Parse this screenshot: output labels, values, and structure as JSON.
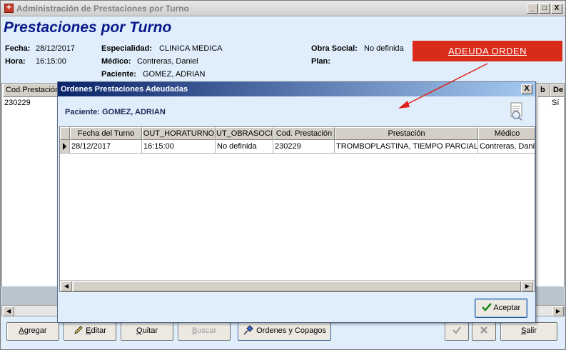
{
  "window": {
    "title": "Administración de Prestaciones por Turno",
    "minimize": "_",
    "maximize": "□",
    "close": "X"
  },
  "heading": "Prestaciones por Turno",
  "info": {
    "fecha_label": "Fecha:",
    "fecha": "28/12/2017",
    "hora_label": "Hora:",
    "hora": "16:15:00",
    "especialidad_label": "Especialidad:",
    "especialidad": "CLINICA MEDICA",
    "medico_label": "Médico:",
    "medico": "Contreras, Daniel",
    "paciente_label": "Paciente:",
    "paciente": "GOMEZ, ADRIAN",
    "obra_social_label": "Obra Social:",
    "obra_social": "No definida",
    "plan_label": "Plan:"
  },
  "alert": "ADEUDA ORDEN",
  "background_grid": {
    "headers": [
      "Cod.Prestación",
      "b",
      "De"
    ],
    "row": [
      "230229",
      "Sí"
    ]
  },
  "dialog": {
    "title": "Ordenes Prestaciones Adeudadas",
    "close": "X",
    "patient": "Paciente: GOMEZ, ADRIAN",
    "columns": [
      "Fecha del Turno",
      "OUT_HORATURNO",
      "UT_OBRASOCIA",
      "Cod. Prestación",
      "Prestación",
      "Médico"
    ],
    "rows": [
      [
        "28/12/2017",
        "16:15:00",
        "No definida",
        "230229",
        "TROMBOPLASTINA, TIEMPO PARCIAL",
        "Contreras, Daniel"
      ]
    ],
    "accept": "Aceptar"
  },
  "buttons": {
    "agregar": "Agregar",
    "editar": "Editar",
    "quitar": "Quitar",
    "buscar": "Buscar",
    "ordenes": "Ordenes y Copagos",
    "salir": "Salir"
  },
  "icons": [
    "app-icon",
    "notes-icon",
    "pencil-icon",
    "pushpin-icon",
    "checkmark-icon",
    "cross-icon",
    "arrow-left-icon",
    "arrow-right-icon",
    "row-pointer-icon"
  ],
  "colors": {
    "heading": "#0a1a8a",
    "alert_bg": "#d92b1a",
    "annotation_arrow": "#e0201a",
    "dialog_title_start": "#0a246a",
    "dialog_title_end": "#a6caf0",
    "window_bg": "#dfeefa"
  }
}
